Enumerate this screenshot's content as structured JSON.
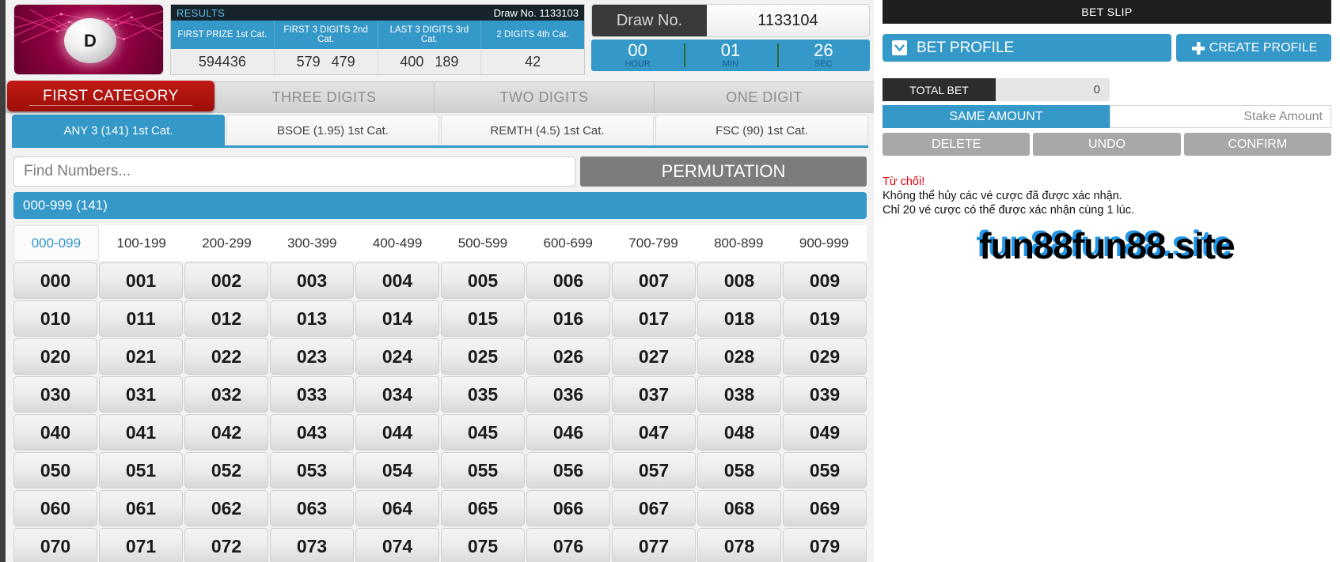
{
  "brand": {
    "ball_letter": "D"
  },
  "results": {
    "title": "RESULTS",
    "draw_label": "Draw No. 1133103",
    "columns": [
      "FIRST PRIZE 1st Cat.",
      "FIRST 3 DIGITS 2nd Cat.",
      "LAST 3 DIGITS 3rd Cat.",
      "2 DIGITS 4th Cat."
    ],
    "values": [
      [
        "594436"
      ],
      [
        "579",
        "479"
      ],
      [
        "400",
        "189"
      ],
      [
        "42"
      ]
    ]
  },
  "draw": {
    "label": "Draw No.",
    "value": "1133104",
    "timer": [
      {
        "num": "00",
        "unit": "HOUR"
      },
      {
        "num": "01",
        "unit": "MIN"
      },
      {
        "num": "26",
        "unit": "SEC"
      }
    ]
  },
  "category_tabs": [
    {
      "label": "FIRST CATEGORY",
      "active": true
    },
    {
      "label": "THREE DIGITS",
      "active": false
    },
    {
      "label": "TWO DIGITS",
      "active": false
    },
    {
      "label": "ONE DIGIT",
      "active": false
    }
  ],
  "sub_tabs": [
    {
      "label": "ANY 3 (141) 1st Cat.",
      "active": true
    },
    {
      "label": "BSOE (1.95) 1st Cat.",
      "active": false
    },
    {
      "label": "REMTH (4.5) 1st Cat.",
      "active": false
    },
    {
      "label": "FSC (90) 1st Cat.",
      "active": false
    }
  ],
  "search": {
    "placeholder": "Find Numbers...",
    "value": "",
    "permutation_label": "PERMUTATION"
  },
  "range_banner": "000-999 (141)",
  "range_tabs": [
    {
      "label": "000-099",
      "active": true
    },
    {
      "label": "100-199",
      "active": false
    },
    {
      "label": "200-299",
      "active": false
    },
    {
      "label": "300-399",
      "active": false
    },
    {
      "label": "400-499",
      "active": false
    },
    {
      "label": "500-599",
      "active": false
    },
    {
      "label": "600-699",
      "active": false
    },
    {
      "label": "700-799",
      "active": false
    },
    {
      "label": "800-899",
      "active": false
    },
    {
      "label": "900-999",
      "active": false
    }
  ],
  "numbers": [
    "000",
    "001",
    "002",
    "003",
    "004",
    "005",
    "006",
    "007",
    "008",
    "009",
    "010",
    "011",
    "012",
    "013",
    "014",
    "015",
    "016",
    "017",
    "018",
    "019",
    "020",
    "021",
    "022",
    "023",
    "024",
    "025",
    "026",
    "027",
    "028",
    "029",
    "030",
    "031",
    "032",
    "033",
    "034",
    "035",
    "036",
    "037",
    "038",
    "039",
    "040",
    "041",
    "042",
    "043",
    "044",
    "045",
    "046",
    "047",
    "048",
    "049",
    "050",
    "051",
    "052",
    "053",
    "054",
    "055",
    "056",
    "057",
    "058",
    "059",
    "060",
    "061",
    "062",
    "063",
    "064",
    "065",
    "066",
    "067",
    "068",
    "069",
    "070",
    "071",
    "072",
    "073",
    "074",
    "075",
    "076",
    "077",
    "078",
    "079"
  ],
  "bet_slip": {
    "title": "BET SLIP",
    "bet_profile_label": "BET PROFILE",
    "create_profile_label": "CREATE PROFILE",
    "total_bet_label": "TOTAL BET",
    "total_bet_value": "0",
    "same_amount_label": "SAME AMOUNT",
    "stake_placeholder": "Stake Amount",
    "stake_value": "",
    "actions": [
      {
        "label": "DELETE"
      },
      {
        "label": "UNDO"
      },
      {
        "label": "CONFIRM"
      }
    ],
    "message": {
      "title": "Từ chối!",
      "line1": "Không thể hủy các vé cược đã được xác nhận.",
      "line2": "Chỉ 20 vé cược có thể được xác nhận cùng 1 lúc."
    },
    "watermark": "fun88fun88.site"
  },
  "colors": {
    "accent_blue": "#3498c9",
    "active_red": "#c01a14",
    "dark_header": "#1f1f1f",
    "error_red": "#e8000a",
    "watermark_blue": "#2196e8"
  }
}
